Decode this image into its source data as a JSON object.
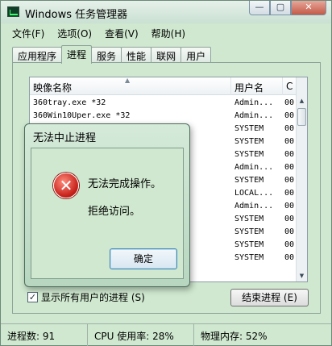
{
  "window": {
    "title": "Windows 任务管理器",
    "buttons": {
      "minimize": "—",
      "maximize": "▢",
      "close": "✕"
    }
  },
  "menu": [
    "文件(F)",
    "选项(O)",
    "查看(V)",
    "帮助(H)"
  ],
  "tabs": [
    {
      "label": "应用程序"
    },
    {
      "label": "进程",
      "active": true
    },
    {
      "label": "服务"
    },
    {
      "label": "性能"
    },
    {
      "label": "联网"
    },
    {
      "label": "用户"
    }
  ],
  "processes": {
    "columns": {
      "name": "映像名称",
      "user": "用户名",
      "cpu": "C"
    },
    "rows": [
      {
        "name": "360tray.exe *32",
        "user": "Admin...",
        "cpu": "00"
      },
      {
        "name": "360Win10Uper.exe *32",
        "user": "Admin...",
        "cpu": "00"
      },
      {
        "name": "",
        "user": "SYSTEM",
        "cpu": "00"
      },
      {
        "name": "",
        "user": "SYSTEM",
        "cpu": "00"
      },
      {
        "name": "",
        "user": "SYSTEM",
        "cpu": "00"
      },
      {
        "name": "",
        "user": "Admin...",
        "cpu": "00"
      },
      {
        "name": "",
        "user": "SYSTEM",
        "cpu": "00"
      },
      {
        "name": "",
        "user": "LOCAL...",
        "cpu": "00"
      },
      {
        "name": "",
        "user": "Admin...",
        "cpu": "00"
      },
      {
        "name": "",
        "user": "SYSTEM",
        "cpu": "00"
      },
      {
        "name": "",
        "user": "SYSTEM",
        "cpu": "00"
      },
      {
        "name": "",
        "user": "SYSTEM",
        "cpu": "00"
      },
      {
        "name": "",
        "user": "SYSTEM",
        "cpu": "00"
      }
    ]
  },
  "show_all_users": {
    "label": "显示所有用户的进程 (S)",
    "checked": true
  },
  "end_process_label": "结束进程 (E)",
  "status": {
    "processes": "进程数: 91",
    "cpu": "CPU 使用率: 28%",
    "memory": "物理内存: 52%"
  },
  "dialog": {
    "title": "无法中止进程",
    "message_line1": "无法完成操作。",
    "message_line2": "拒绝访问。",
    "ok_label": "确定",
    "icon_glyph": "✕"
  }
}
